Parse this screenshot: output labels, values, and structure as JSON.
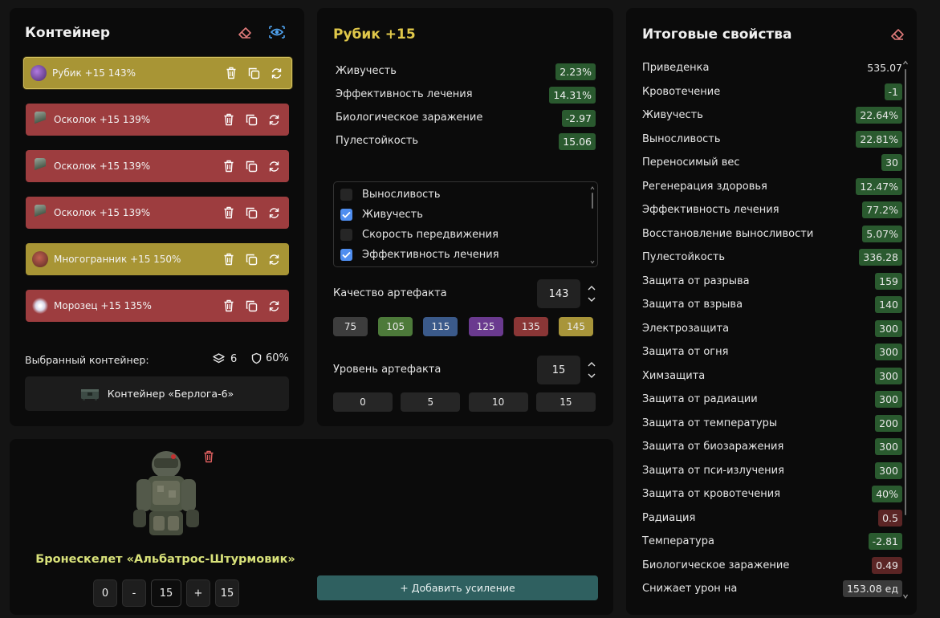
{
  "container_panel": {
    "title": "Контейнер",
    "artifacts": [
      {
        "name": "Рубик +15 143%",
        "color": "yellow",
        "icon": "cube-artifact-icon",
        "selected": true
      },
      {
        "name": "Осколок +15 139%",
        "color": "red",
        "icon": "shard-artifact-icon",
        "selected": false
      },
      {
        "name": "Осколок +15 139%",
        "color": "red",
        "icon": "shard-artifact-icon",
        "selected": false
      },
      {
        "name": "Осколок +15 139%",
        "color": "red",
        "icon": "shard-artifact-icon",
        "selected": false
      },
      {
        "name": "Многогранник +15 150%",
        "color": "yellow",
        "icon": "polyhedron-artifact-icon",
        "selected": false
      },
      {
        "name": "Морозец +15 135%",
        "color": "red",
        "icon": "frost-artifact-icon",
        "selected": false
      }
    ],
    "selected_container_label": "Выбранный контейнер:",
    "slots": "6",
    "protection": "60%",
    "container_name": "Контейнер «Берлога-6»"
  },
  "artifact_panel": {
    "title": "Рубик +15",
    "title_color": "#e0c84a",
    "stats": [
      {
        "label": "Живучесть",
        "value": "2.23%",
        "tone": "green"
      },
      {
        "label": "Эффективность лечения",
        "value": "14.31%",
        "tone": "green"
      },
      {
        "label": "Биологическое заражение",
        "value": "-2.97",
        "tone": "green"
      },
      {
        "label": "Пулестойкость",
        "value": "15.06",
        "tone": "green"
      }
    ],
    "checklist": [
      {
        "label": "Выносливость",
        "checked": false
      },
      {
        "label": "Живучесть",
        "checked": true
      },
      {
        "label": "Скорость передвижения",
        "checked": false
      },
      {
        "label": "Эффективность лечения",
        "checked": true
      }
    ],
    "quality_label": "Качество артефакта",
    "quality_value": "143",
    "quality_presets": [
      {
        "label": "75",
        "color": "#3d3d3d"
      },
      {
        "label": "105",
        "color": "#4d7a3a"
      },
      {
        "label": "115",
        "color": "#3b5a8a"
      },
      {
        "label": "125",
        "color": "#6a3a8f"
      },
      {
        "label": "135",
        "color": "#8a3636"
      },
      {
        "label": "145",
        "color": "#a8953a"
      }
    ],
    "level_label": "Уровень артефакта",
    "level_value": "15",
    "level_presets": [
      "0",
      "5",
      "10",
      "15"
    ]
  },
  "armor_panel": {
    "name": "Бронескелет «Альбатрос-Штурмовик»",
    "name_color": "#d9e27a",
    "stepper": [
      "0",
      "-",
      "15",
      "+",
      "15"
    ],
    "add_button": "+ Добавить усиление"
  },
  "totals_panel": {
    "title": "Итоговые свойства",
    "rows": [
      {
        "label": "Приведенка",
        "value": "535.07",
        "tone": "plain"
      },
      {
        "label": "Кровотечение",
        "value": "-1",
        "tone": "green"
      },
      {
        "label": "Живучесть",
        "value": "22.64%",
        "tone": "green"
      },
      {
        "label": "Выносливость",
        "value": "22.81%",
        "tone": "green"
      },
      {
        "label": "Переносимый вес",
        "value": "30",
        "tone": "green"
      },
      {
        "label": "Регенерация здоровья",
        "value": "12.47%",
        "tone": "green"
      },
      {
        "label": "Эффективность лечения",
        "value": "77.2%",
        "tone": "green"
      },
      {
        "label": "Восстановление выносливости",
        "value": "5.07%",
        "tone": "green"
      },
      {
        "label": "Пулестойкость",
        "value": "336.28",
        "tone": "green"
      },
      {
        "label": "Защита от разрыва",
        "value": "159",
        "tone": "green"
      },
      {
        "label": "Защита от взрыва",
        "value": "140",
        "tone": "green"
      },
      {
        "label": "Электрозащита",
        "value": "300",
        "tone": "green"
      },
      {
        "label": "Защита от огня",
        "value": "300",
        "tone": "green"
      },
      {
        "label": "Химзащита",
        "value": "300",
        "tone": "green"
      },
      {
        "label": "Защита от радиации",
        "value": "300",
        "tone": "green"
      },
      {
        "label": "Защита от температуры",
        "value": "200",
        "tone": "green"
      },
      {
        "label": "Защита от биозаражения",
        "value": "300",
        "tone": "green"
      },
      {
        "label": "Защита от пси-излучения",
        "value": "300",
        "tone": "green"
      },
      {
        "label": "Защита от кровотечения",
        "value": "40%",
        "tone": "green"
      },
      {
        "label": "Радиация",
        "value": "0.5",
        "tone": "red"
      },
      {
        "label": "Температура",
        "value": "-2.81",
        "tone": "green"
      },
      {
        "label": "Биологическое заражение",
        "value": "0.49",
        "tone": "red"
      },
      {
        "label": "Снижает урон на",
        "value": "153.08 ед",
        "tone": "gray"
      }
    ]
  }
}
